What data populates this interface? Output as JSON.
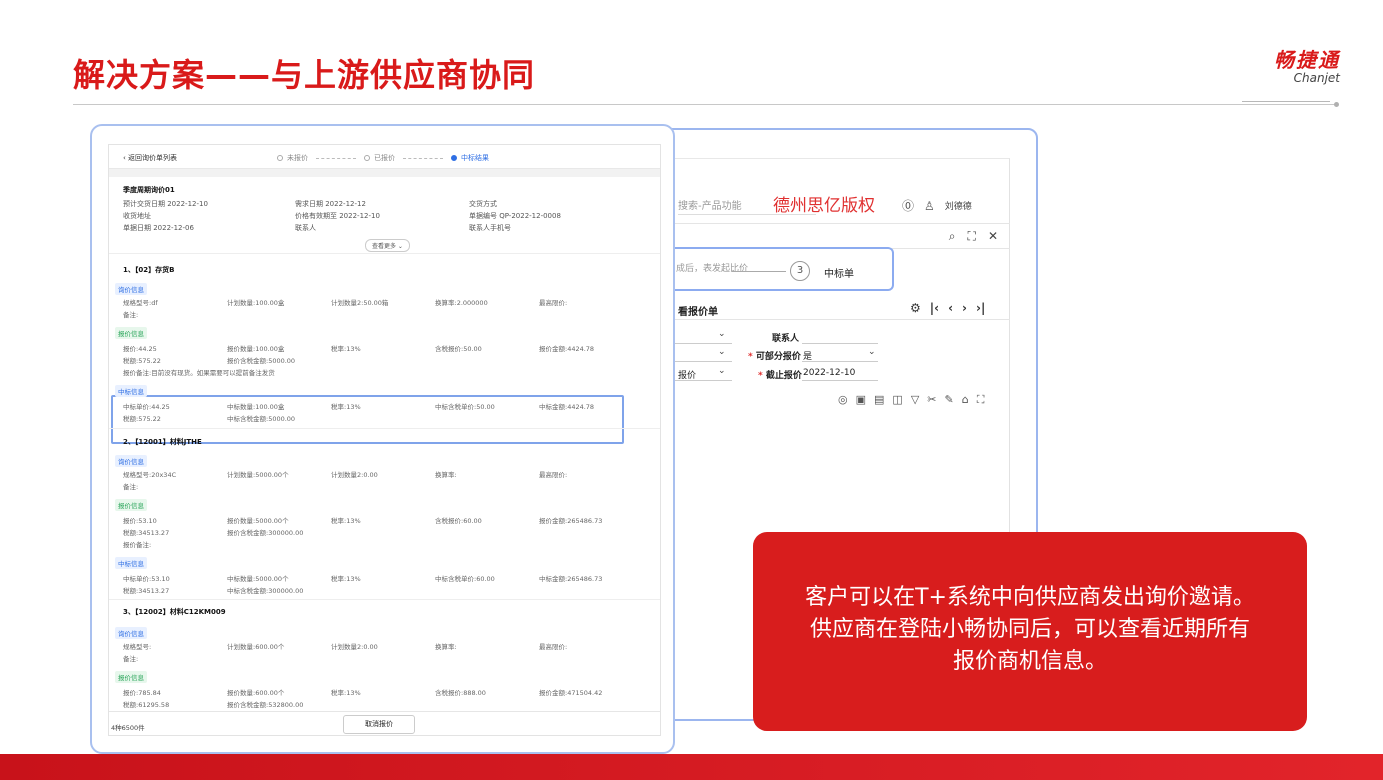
{
  "slide": {
    "title": "解决方案——与上游供应商协同",
    "logo_cn": "畅捷通",
    "logo_en": "Chanjet",
    "accent": "#d91a1a"
  },
  "back_app": {
    "search_placeholder": "搜索-产品功能",
    "watermark": "德州思亿版权",
    "user": "刘德德",
    "steps_text": "成后，表发起比价",
    "step_number": "3",
    "step_label": "中标单",
    "section_title": "看报价单",
    "contact_label": "联系人",
    "partial_quote_label": "可部分报价",
    "partial_quote_value": "是",
    "deadline_label": "截止报价",
    "deadline_value": "2022-12-10",
    "left_select3": "报价"
  },
  "front_app": {
    "back_link": "返回询价单列表",
    "steps": [
      "未报价",
      "已报价",
      "中标结果"
    ],
    "inquiry_name": "季度周期询价01",
    "meta": {
      "expected_date": "预计交货日期 2022-12-10",
      "receive_address": "收货地址",
      "doc_date": "单据日期 2022-12-06",
      "demand_date": "需求日期 2022-12-12",
      "price_valid": "价格有效期至 2022-12-10",
      "contact": "联系人",
      "delivery_method": "交货方式",
      "doc_no": "单据编号 QP-2022-12-0008",
      "contact_phone": "联系人手机号"
    },
    "more_button": "查看更多",
    "tags": {
      "inquiry": "询价信息",
      "quote": "报价信息",
      "award": "中标信息"
    },
    "items": [
      {
        "title": "1、【02】存货B",
        "inq": [
          "规格型号:df",
          "计划数量:100.00盒",
          "计划数量2:50.00箱",
          "换算率:2.000000",
          "最高限价:"
        ],
        "inq_note": "备注:",
        "quote": [
          "报价:44.25",
          "报价数量:100.00盒",
          "税率:13%",
          "含税报价:50.00",
          "报价金额:4424.78"
        ],
        "quote2": [
          "税额:575.22",
          "报价含税金额:5000.00"
        ],
        "quote_note": "报价备注:目前没有现货。如果需要可以提前备注发货",
        "award": [
          "中标单价:44.25",
          "中标数量:100.00盒",
          "税率:13%",
          "中标含税单价:50.00",
          "中标金额:4424.78"
        ],
        "award2": [
          "税额:575.22",
          "中标含税金额:5000.00"
        ]
      },
      {
        "title": "2、【12001】材料JTHE",
        "inq": [
          "规格型号:20x34C",
          "计划数量:5000.00个",
          "计划数量2:0.00",
          "换算率:",
          "最高限价:"
        ],
        "inq_note": "备注:",
        "quote": [
          "报价:53.10",
          "报价数量:5000.00个",
          "税率:13%",
          "含税报价:60.00",
          "报价金额:265486.73"
        ],
        "quote2": [
          "税额:34513.27",
          "报价含税金额:300000.00"
        ],
        "quote_note": "报价备注:",
        "award": [
          "中标单价:53.10",
          "中标数量:5000.00个",
          "税率:13%",
          "中标含税单价:60.00",
          "中标金额:265486.73"
        ],
        "award2": [
          "税额:34513.27",
          "中标含税金额:300000.00"
        ]
      },
      {
        "title": "3、【12002】材料C12KM009",
        "inq": [
          "规格型号:",
          "计划数量:600.00个",
          "计划数量2:0.00",
          "换算率:",
          "最高限价:"
        ],
        "inq_note": "备注:",
        "quote": [
          "报价:785.84",
          "报价数量:600.00个",
          "税率:13%",
          "含税报价:888.00",
          "报价金额:471504.42"
        ],
        "quote2": [
          "税额:61295.58",
          "报价含税金额:532800.00"
        ]
      }
    ],
    "footer_count": "4种6500件",
    "cancel_button": "取消报价"
  },
  "callout": {
    "line1": "客户可以在T+系统中向供应商发出询价邀请。",
    "line2": "供应商在登陆小畅协同后，可以查看近期所有",
    "line3": "报价商机信息。",
    "color": "#d81d1d"
  }
}
